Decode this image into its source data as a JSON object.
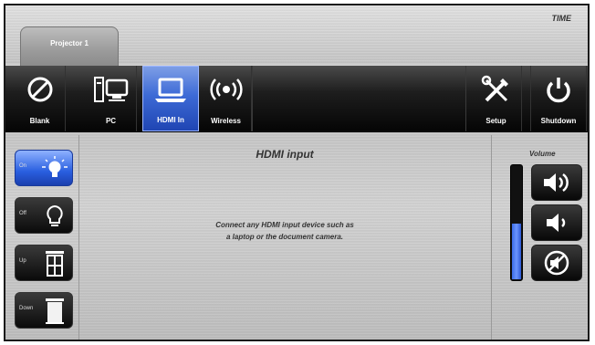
{
  "header": {
    "time": "TIME",
    "room_tab": "Projector 1"
  },
  "toolbar": {
    "blank": "Blank",
    "pc": "PC",
    "hdmi": "HDMI In",
    "wireless": "Wireless",
    "setup": "Setup",
    "shutdown": "Shutdown",
    "active": "hdmi"
  },
  "left_controls": {
    "on": "On",
    "off": "Off",
    "up": "Up",
    "down": "Down"
  },
  "main": {
    "title": "HDMI input",
    "message_line1": "Connect any HDMI input device such as",
    "message_line2": "a laptop or the document camera."
  },
  "volume": {
    "label": "Volume",
    "level_percent": 50
  },
  "colors": {
    "accent": "#2f5fd8",
    "toolbar": "#0a0a0a"
  }
}
